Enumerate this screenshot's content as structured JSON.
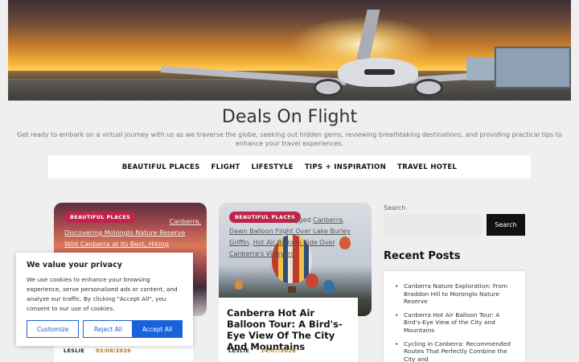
{
  "site": {
    "title": "Deals On Flight",
    "tagline": "Get ready to embark on a virtual journey with us as we traverse the globe, seeking out hidden gems, reviewing breathtaking destinations, and providing practical tips to enhance your travel experiences."
  },
  "nav": {
    "items": [
      "BEAUTIFUL PLACES",
      "FLIGHT",
      "LIFESTYLE",
      "TIPS + INSPIRATION",
      "TRAVEL HOTEL"
    ]
  },
  "posts": [
    {
      "category": "BEAUTIFUL PLACES",
      "overlay_lines": [
        "Canberra,",
        "Discovering Molonglo Nature Reserve",
        "Wild Canberra at its Best, Hiking"
      ],
      "author": "LESLIE",
      "date": "03/08/2026"
    },
    {
      "category": "BEAUTIFUL PLACES",
      "tagged_label": "Tagged",
      "tags": [
        "Canberra",
        "Dawn Balloon Flight Over Lake Burley Griffin",
        "Hot Air Balloon Ride Over Canberra's Vineyard"
      ],
      "title": "Canberra Hot Air Balloon Tour: A Bird's-Eye View Of The City And Mountains",
      "author": "LESLIE",
      "date": "14/07/2026"
    }
  ],
  "sidebar": {
    "search_label": "Search",
    "search_placeholder": "",
    "search_button": "Search",
    "recent_title": "Recent Posts",
    "recent_posts": [
      "Canberra Nature Exploration: From Braddon Hill to Moronglo Nature Reserve",
      "Canberra Hot Air Balloon Tour: A Bird's-Eye View of the City and Mountains",
      "Cycling in Canberra: Recommended Routes That Perfectly Combine the City and"
    ]
  },
  "cookie": {
    "title": "We value your privacy",
    "text": "We use cookies to enhance your browsing experience, serve personalized ads or content, and analyze our traffic. By clicking \"Accept All\", you consent to our use of cookies.",
    "customize": "Customize",
    "reject": "Reject All",
    "accept": "Accept All"
  },
  "colors": {
    "badge": "#c0244a",
    "cookie_accent": "#1863dc",
    "date": "#a57d14"
  }
}
